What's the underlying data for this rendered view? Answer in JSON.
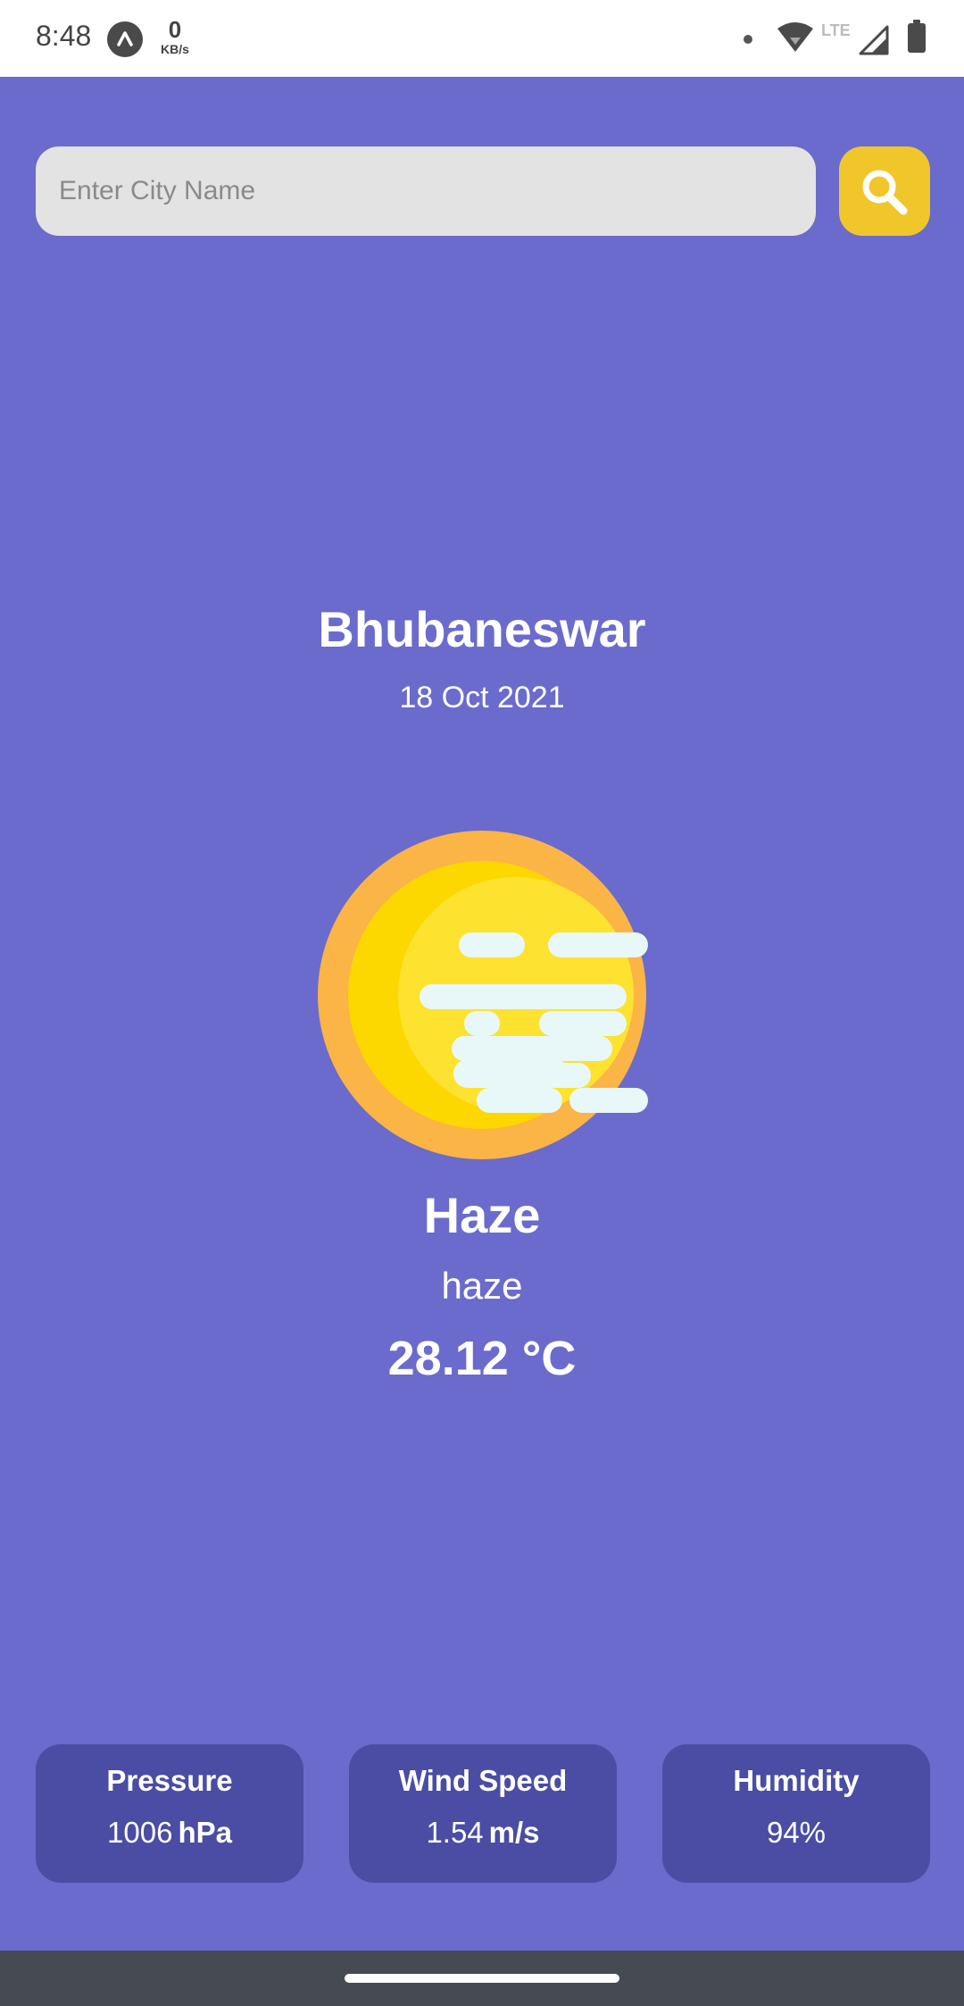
{
  "status_bar": {
    "time": "8:48",
    "net_speed_value": "0",
    "net_speed_unit": "KB/s",
    "network_type": "LTE"
  },
  "search": {
    "placeholder": "Enter City Name",
    "value": ""
  },
  "weather": {
    "city": "Bhubaneswar",
    "date": "18 Oct 2021",
    "condition": "Haze",
    "description": "haze",
    "temperature": "28.12 °C",
    "icon": "haze-sun-icon"
  },
  "stats": [
    {
      "label": "Pressure",
      "value": "1006",
      "unit": "hPa"
    },
    {
      "label": "Wind Speed",
      "value": "1.54",
      "unit": "m/s"
    },
    {
      "label": "Humidity",
      "value": "94%",
      "unit": ""
    }
  ],
  "colors": {
    "background": "#6a6bcc",
    "card": "#4a4da3",
    "search_button": "#f0c62b",
    "search_field": "#e3e3e3"
  }
}
